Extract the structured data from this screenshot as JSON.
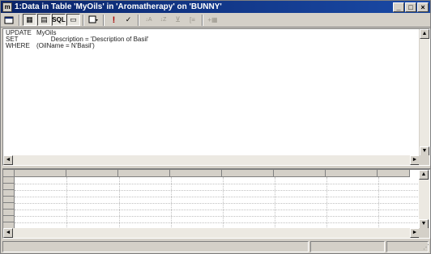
{
  "window": {
    "app_icon_label": "m",
    "title": "1:Data in Table 'MyOils' in 'Aromatherapy' on 'BUNNY'",
    "minimize_glyph": "_",
    "maximize_glyph": "□",
    "close_glyph": "×"
  },
  "toolbar": {
    "sql_label": "SQL",
    "glyphs": {
      "run": "!",
      "diagram": "▦",
      "grid": "▤",
      "results": "▭",
      "verify": "✓",
      "sort_asc": "↓A",
      "sort_desc": "↓Z",
      "filter": "⊽",
      "remove_filter": "⊻",
      "group_by": "[≡",
      "add_table": "+▦"
    }
  },
  "sql": {
    "lines": [
      {
        "keyword": "UPDATE",
        "text": "MyOils"
      },
      {
        "keyword": "SET",
        "text": "        Description = 'Description of Basil'"
      },
      {
        "keyword": "WHERE",
        "text": "(OilName = N'Basil')"
      }
    ]
  },
  "scroll": {
    "up": "▲",
    "down": "▼",
    "left": "◄",
    "right": "►"
  },
  "statusbar": {
    "grip": "⋰"
  }
}
